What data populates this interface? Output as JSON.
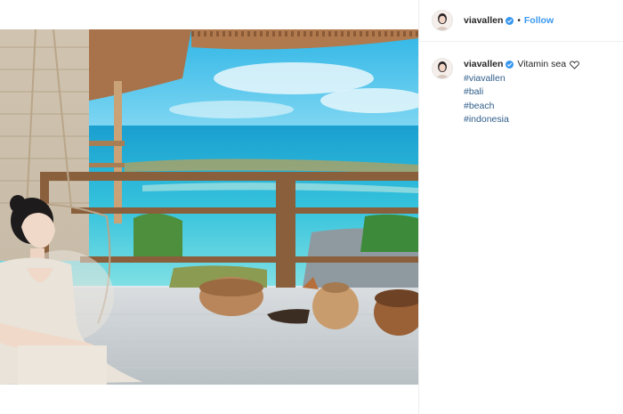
{
  "post": {
    "username": "viavallen",
    "follow_label": "Follow",
    "separator": "•",
    "caption": "Vitamin sea",
    "hashtags": [
      "#viavallen",
      "#bali",
      "#beach",
      "#indonesia"
    ]
  },
  "icons": {
    "verified": "verified-badge-icon",
    "heart": "heart-outline-icon"
  },
  "colors": {
    "link_blue": "#3897f0",
    "hashtag_blue": "#2f5d8a",
    "verified_blue": "#3897f0"
  }
}
